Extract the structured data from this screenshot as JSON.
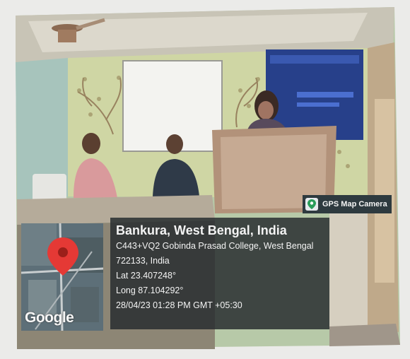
{
  "badge": {
    "label": "GPS Map Camera",
    "icon": "map-pin-icon"
  },
  "map": {
    "watermark": "Google",
    "marker_icon": "location-pin-icon",
    "marker_color": "#e53935"
  },
  "location": {
    "title": "Bankura, West Bengal, India",
    "address": "C443+VQ2 Gobinda Prasad College, West Bengal",
    "postal": "722133, India",
    "lat": "Lat 23.407248°",
    "long": "Long 87.104292°",
    "datetime": "28/04/23 01:28 PM GMT +05:30"
  }
}
